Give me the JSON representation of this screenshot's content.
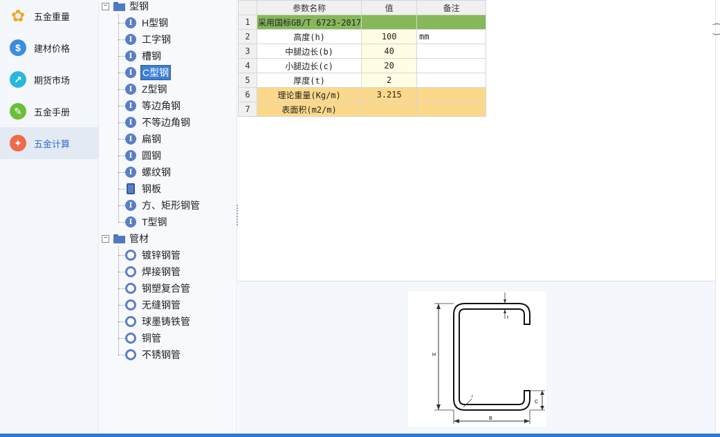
{
  "nav": {
    "items": [
      {
        "label": "五金重量",
        "icon": "orange-petal-icon",
        "color": "#f5a623"
      },
      {
        "label": "建材价格",
        "icon": "dollar-icon",
        "color": "#3b8de0"
      },
      {
        "label": "期货市场",
        "icon": "trend-chart-icon",
        "color": "#2ab7d9"
      },
      {
        "label": "五金手册",
        "icon": "wrench-icon",
        "color": "#6cbf3a"
      },
      {
        "label": "五金计算",
        "icon": "magic-wand-icon",
        "color": "#ee6a4a"
      }
    ],
    "active_index": 4
  },
  "tree": {
    "categories": [
      {
        "label": "型钢",
        "toggle": "−",
        "items": [
          {
            "label": "H型钢",
            "icon": "I"
          },
          {
            "label": "工字钢",
            "icon": "I"
          },
          {
            "label": "槽钢",
            "icon": "I"
          },
          {
            "label": "C型钢",
            "icon": "I",
            "selected": true
          },
          {
            "label": "Z型钢",
            "icon": "I"
          },
          {
            "label": "等边角钢",
            "icon": "I"
          },
          {
            "label": "不等边角钢",
            "icon": "I"
          },
          {
            "label": "扁钢",
            "icon": "I"
          },
          {
            "label": "圆钢",
            "icon": "I"
          },
          {
            "label": "螺纹钢",
            "icon": "I"
          },
          {
            "label": "钢板",
            "icon": "plate"
          },
          {
            "label": "方、矩形钢管",
            "icon": "I"
          },
          {
            "label": "T型钢",
            "icon": "I"
          }
        ]
      },
      {
        "label": "管材",
        "toggle": "−",
        "items": [
          {
            "label": "镀锌钢管",
            "icon": "ring"
          },
          {
            "label": "焊接钢管",
            "icon": "ring"
          },
          {
            "label": "钢塑复合管",
            "icon": "ring"
          },
          {
            "label": "无缝钢管",
            "icon": "ring"
          },
          {
            "label": "球墨铸铁管",
            "icon": "ring"
          },
          {
            "label": "铜管",
            "icon": "ring"
          },
          {
            "label": "不锈钢管",
            "icon": "ring"
          }
        ]
      }
    ]
  },
  "grid": {
    "headers": [
      "",
      "参数名称",
      "值",
      "备注"
    ],
    "rows": [
      {
        "num": "1",
        "name": "采用国标GB/T 6723-2017",
        "value": "",
        "note": "",
        "style": "green"
      },
      {
        "num": "2",
        "name": "高度(h)",
        "value": "100",
        "note": "mm",
        "style": "input"
      },
      {
        "num": "3",
        "name": "中腿边长(b)",
        "value": "40",
        "note": "",
        "style": "input"
      },
      {
        "num": "4",
        "name": "小腿边长(c)",
        "value": "20",
        "note": "",
        "style": "input"
      },
      {
        "num": "5",
        "name": "厚度(t)",
        "value": "2",
        "note": "",
        "style": "input"
      },
      {
        "num": "6",
        "name": "理论重量(Kg/m)",
        "value": "3.215",
        "note": "",
        "style": "orange"
      },
      {
        "num": "7",
        "name": "表面积(m2/m)",
        "value": "",
        "note": "",
        "style": "orange"
      }
    ]
  },
  "diagram": {
    "labels": {
      "h": "H",
      "b": "B",
      "c": "C",
      "t": "t",
      "r": "r"
    }
  },
  "right_mark": "⁐"
}
